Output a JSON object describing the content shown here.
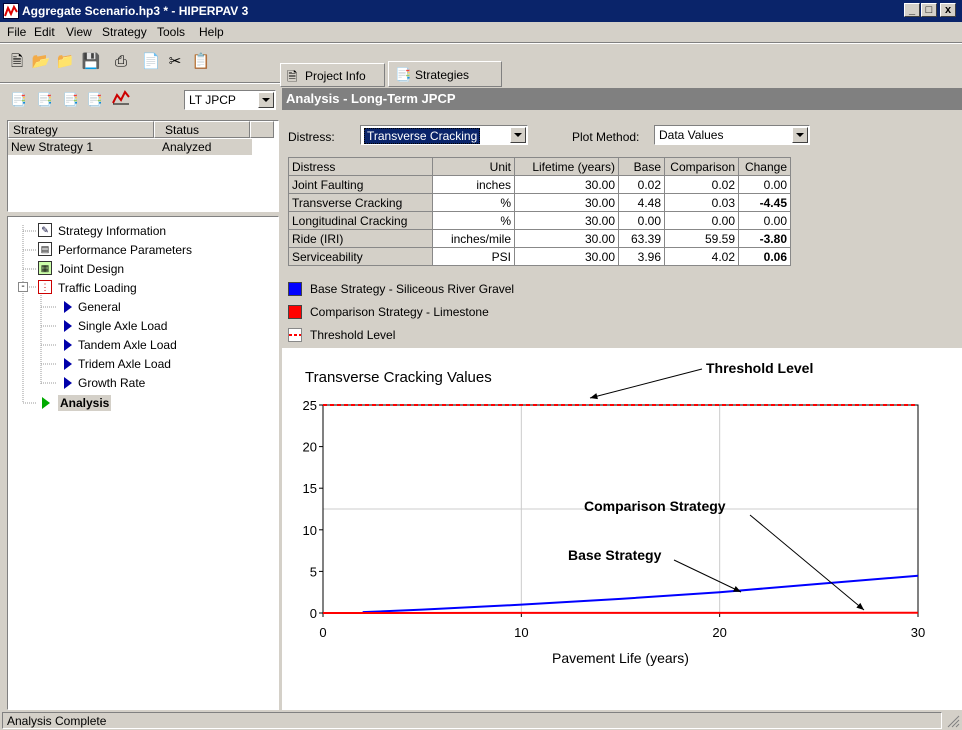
{
  "window": {
    "title": "Aggregate Scenario.hp3 * - HIPERPAV 3",
    "min": "_",
    "max": "□",
    "close": "x"
  },
  "menu": [
    "File",
    "Edit",
    "View",
    "Strategy",
    "Tools",
    "Help"
  ],
  "toolbar": {
    "mode_select": "LT JPCP"
  },
  "tabs": {
    "project": "Project Info",
    "strategies": "Strategies"
  },
  "section_title": "Analysis - Long-Term JPCP",
  "strategies_list": {
    "headers": [
      "Strategy",
      "Status"
    ],
    "rows": [
      {
        "name": "New Strategy 1",
        "status": "Analyzed"
      }
    ]
  },
  "tree": {
    "items": [
      {
        "label": "Strategy Information"
      },
      {
        "label": "Performance Parameters"
      },
      {
        "label": "Joint Design"
      },
      {
        "label": "Traffic Loading"
      },
      {
        "label": "General"
      },
      {
        "label": "Single Axle Load"
      },
      {
        "label": "Tandem Axle Load"
      },
      {
        "label": "Tridem Axle Load"
      },
      {
        "label": "Growth Rate"
      },
      {
        "label": "Analysis"
      }
    ]
  },
  "controls": {
    "distress_label": "Distress:",
    "distress_value": "Transverse Cracking",
    "plot_label": "Plot Method:",
    "plot_value": "Data Values"
  },
  "table": {
    "headers": [
      "Distress",
      "Unit",
      "Lifetime (years)",
      "Base",
      "Comparison",
      "Change"
    ],
    "rows": [
      [
        "Joint Faulting",
        "inches",
        "30.00",
        "0.02",
        "0.02",
        "0.00"
      ],
      [
        "Transverse Cracking",
        "%",
        "30.00",
        "4.48",
        "0.03",
        "-4.45"
      ],
      [
        "Longitudinal Cracking",
        "%",
        "30.00",
        "0.00",
        "0.00",
        "0.00"
      ],
      [
        "Ride (IRI)",
        "inches/mile",
        "30.00",
        "63.39",
        "59.59",
        "-3.80"
      ],
      [
        "Serviceability",
        "PSI",
        "30.00",
        "3.96",
        "4.02",
        "0.06"
      ]
    ]
  },
  "legend": [
    {
      "label": "Base Strategy - Siliceous River Gravel",
      "color": "#0000ff"
    },
    {
      "label": "Comparison Strategy - Limestone",
      "color": "#ff0000"
    },
    {
      "label": "Threshold Level",
      "color": "#ff0000"
    }
  ],
  "chart_data": {
    "type": "line",
    "title": "Transverse Cracking Values",
    "xlabel": "Pavement Life (years)",
    "ylabel": "",
    "xlim": [
      0,
      30
    ],
    "ylim": [
      0,
      25
    ],
    "x_ticks": [
      "0",
      "10",
      "20",
      "30"
    ],
    "y_ticks": [
      "0",
      "5",
      "10",
      "15",
      "20",
      "25"
    ],
    "grid": true,
    "series": [
      {
        "name": "Base Strategy",
        "color": "#0000ff",
        "points": [
          [
            2,
            0.1
          ],
          [
            5,
            0.4
          ],
          [
            10,
            1.0
          ],
          [
            15,
            1.7
          ],
          [
            20,
            2.5
          ],
          [
            25,
            3.5
          ],
          [
            30,
            4.48
          ]
        ]
      },
      {
        "name": "Comparison Strategy",
        "color": "#ff0000",
        "points": [
          [
            0,
            0
          ],
          [
            10,
            0.01
          ],
          [
            20,
            0.02
          ],
          [
            30,
            0.03
          ]
        ]
      },
      {
        "name": "Threshold Level",
        "color": "#ff0000",
        "dashed": true,
        "points": [
          [
            0,
            25
          ],
          [
            30,
            25
          ]
        ]
      }
    ],
    "annotations": [
      "Threshold Level",
      "Comparison Strategy",
      "Base Strategy"
    ]
  },
  "status": "Analysis Complete"
}
